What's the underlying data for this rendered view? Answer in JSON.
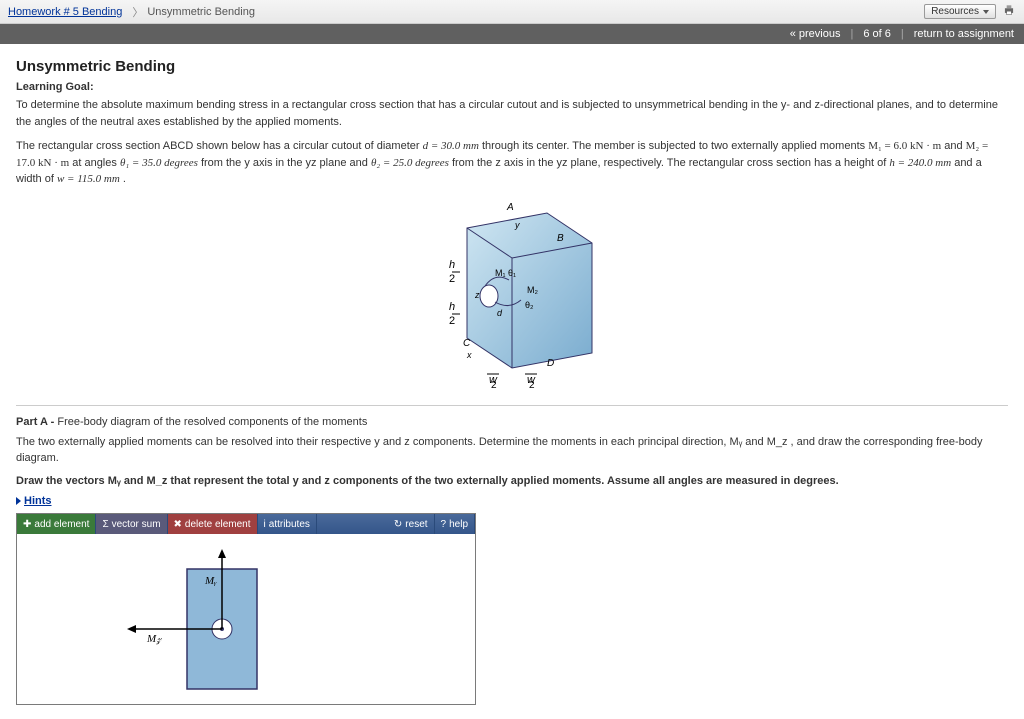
{
  "breadcrumb": {
    "parent": "Homework # 5 Bending",
    "current": "Unsymmetric Bending"
  },
  "topright": {
    "resources": "Resources"
  },
  "nav": {
    "previous": "« previous",
    "counter": "6 of 6",
    "return": "return to assignment"
  },
  "title": "Unsymmetric Bending",
  "learning_goal_label": "Learning Goal:",
  "learning_goal_text": "To determine the absolute maximum bending stress in a rectangular cross section that has a circular cutout and is subjected to unsymmetrical bending in the y- and z-directional planes, and to determine the angles of the neutral axes established by the applied moments.",
  "problem": {
    "lead": "The rectangular cross section ABCD shown below has a circular cutout of diameter ",
    "d_eq": "d = 30.0 mm",
    "mid1": " through its center. The member is subjected to two externally applied moments ",
    "M1": "M₁ = 6.0 kN · m",
    "and": " and ",
    "M2": "M₂ = 17.0 kN · m",
    "mid2": " at angles ",
    "th1": "θ₁ = 35.0 degrees",
    "mid3": " from the y axis in the yz plane and ",
    "th2": "θ₂ = 25.0 degrees",
    "mid4": " from the z axis in the yz plane, respectively. The rectangular cross section has a height of ",
    "h": "h = 240.0 mm",
    "mid5": " and a width of ",
    "w": "w = 115.0 mm",
    "end": " ."
  },
  "partA": {
    "label": "Part A - ",
    "title": "Free-body diagram of the resolved components of the moments",
    "text1": "The two externally applied moments can be resolved into their respective y and z components. Determine the moments in each principal direction, Mᵧ and M_z , and draw the corresponding free-body diagram.",
    "text2": "Draw the vectors Mᵧ and M_z that represent the total y and z components of the two externally applied moments. Assume all angles are measured in degrees.",
    "hints": "Hints"
  },
  "toolbar": {
    "add": "add element",
    "sum": "vector sum",
    "del": "delete element",
    "attr": "attributes",
    "reset": "reset",
    "help": "help"
  },
  "canvas_labels": {
    "My": "Mᵧ",
    "Mz": "M_z"
  }
}
